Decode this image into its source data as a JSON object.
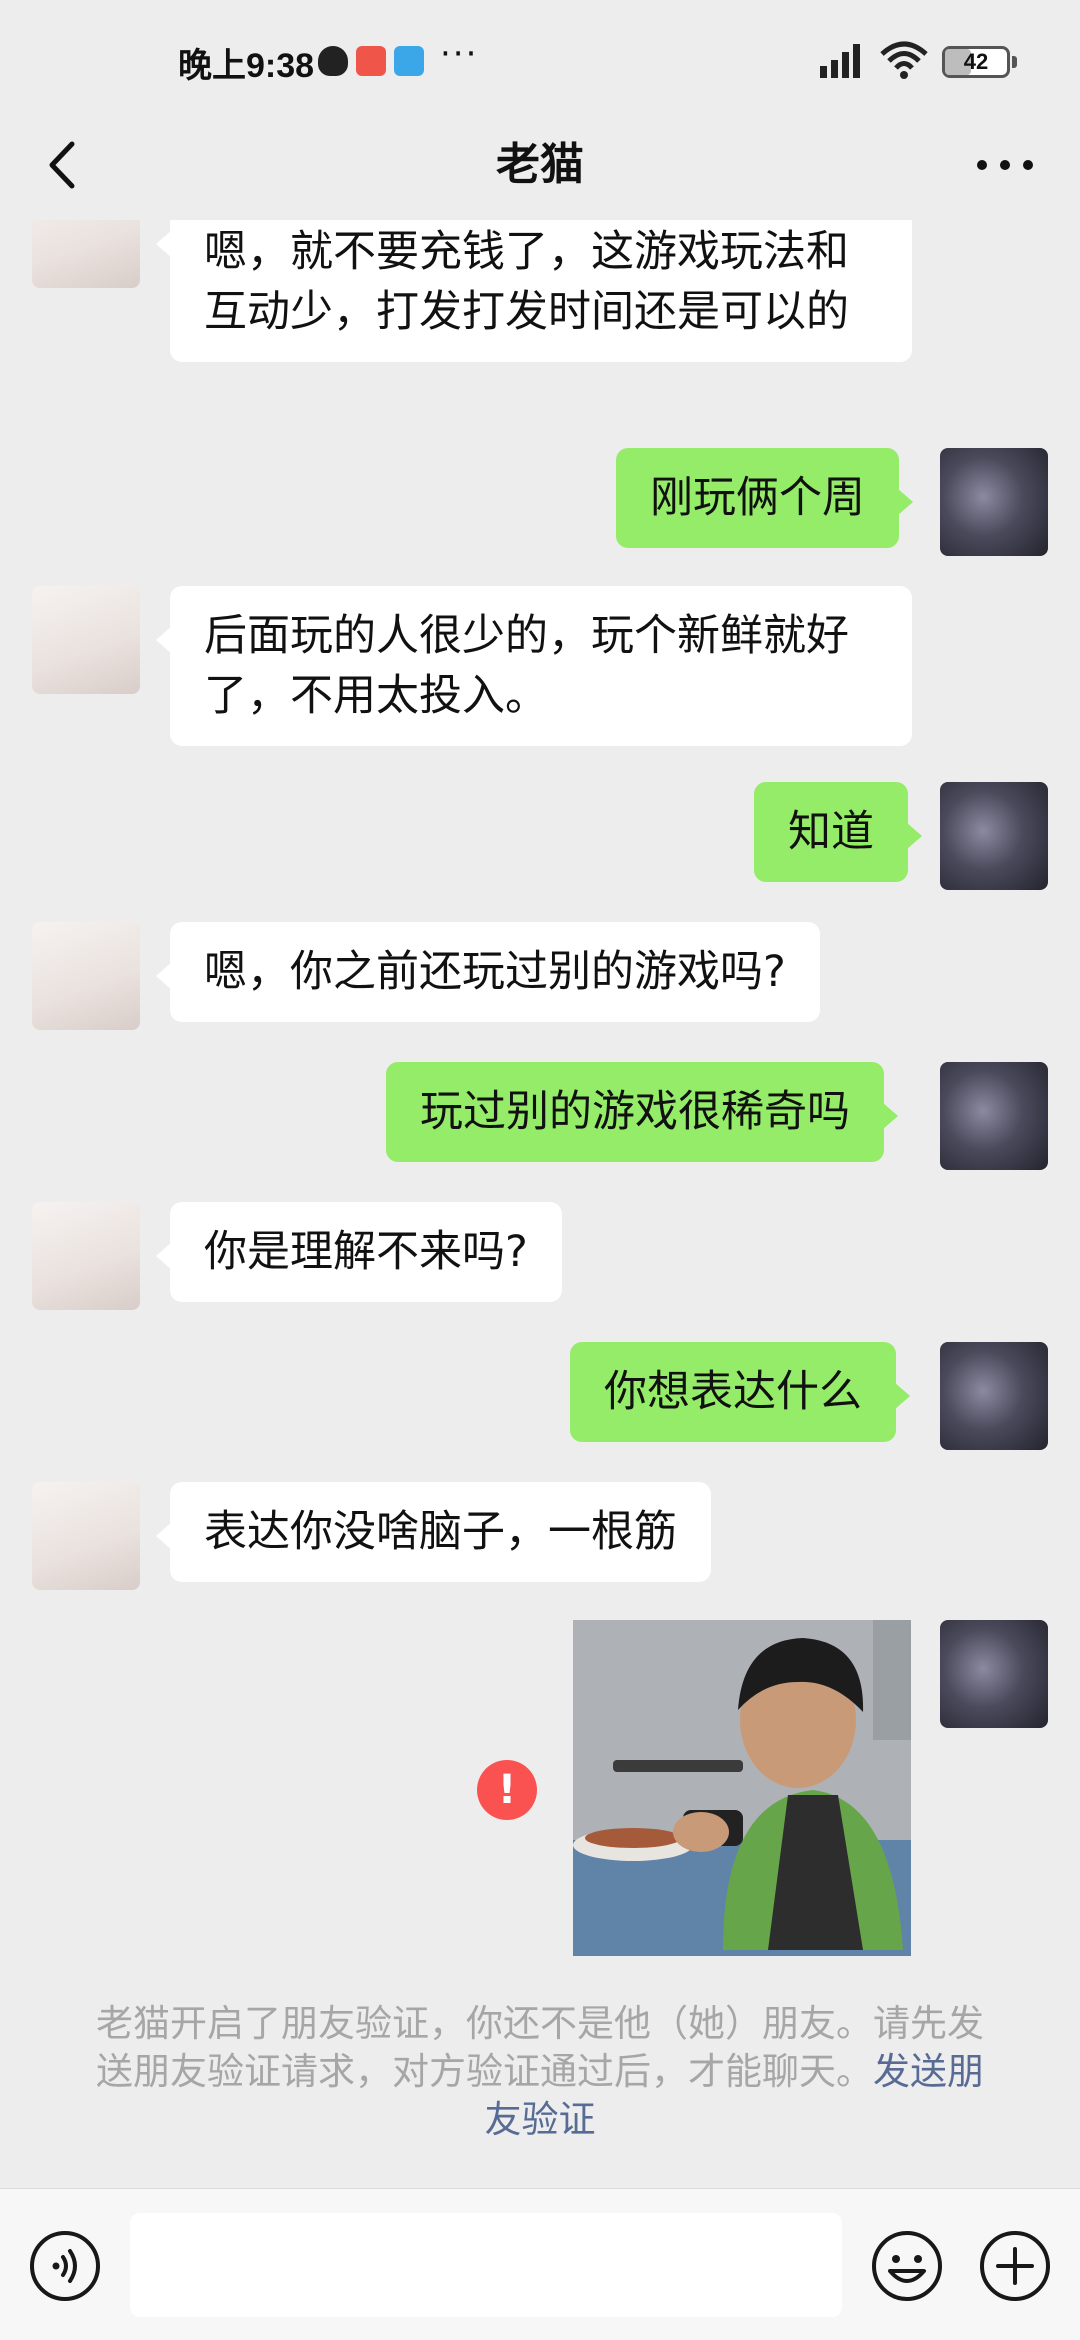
{
  "status_bar": {
    "time": "晚上9:38",
    "dots": "···",
    "battery": "42"
  },
  "header": {
    "title": "老猫"
  },
  "messages": [
    {
      "from": "other",
      "text": "嗯，就不要充钱了，这游戏玩法和互动少，打发打发时间还是可以的"
    },
    {
      "from": "me",
      "text": "刚玩俩个周"
    },
    {
      "from": "other",
      "text": "后面玩的人很少的，玩个新鲜就好了，不用太投入。"
    },
    {
      "from": "me",
      "text": "知道"
    },
    {
      "from": "other",
      "text": "嗯，你之前还玩过别的游戏吗?"
    },
    {
      "from": "me",
      "text": "玩过别的游戏很稀奇吗"
    },
    {
      "from": "other",
      "text": "你是理解不来吗?"
    },
    {
      "from": "me",
      "text": "你想表达什么"
    },
    {
      "from": "other",
      "text": "表达你没啥脑子，一根筋"
    }
  ],
  "error_badge": "!",
  "notice": {
    "text": "老猫开启了朋友验证，你还不是他（她）朋友。请先发送朋友验证请求，对方验证通过后，才能聊天。",
    "link": "发送朋友验证"
  },
  "colors": {
    "background": "#ededed",
    "my_bubble": "#95ec69",
    "other_bubble": "#ffffff",
    "link": "#576b95",
    "error": "#fa5151"
  },
  "icons": [
    "back-arrow-icon",
    "more-icon",
    "voice-icon",
    "emoji-icon",
    "plus-icon"
  ]
}
